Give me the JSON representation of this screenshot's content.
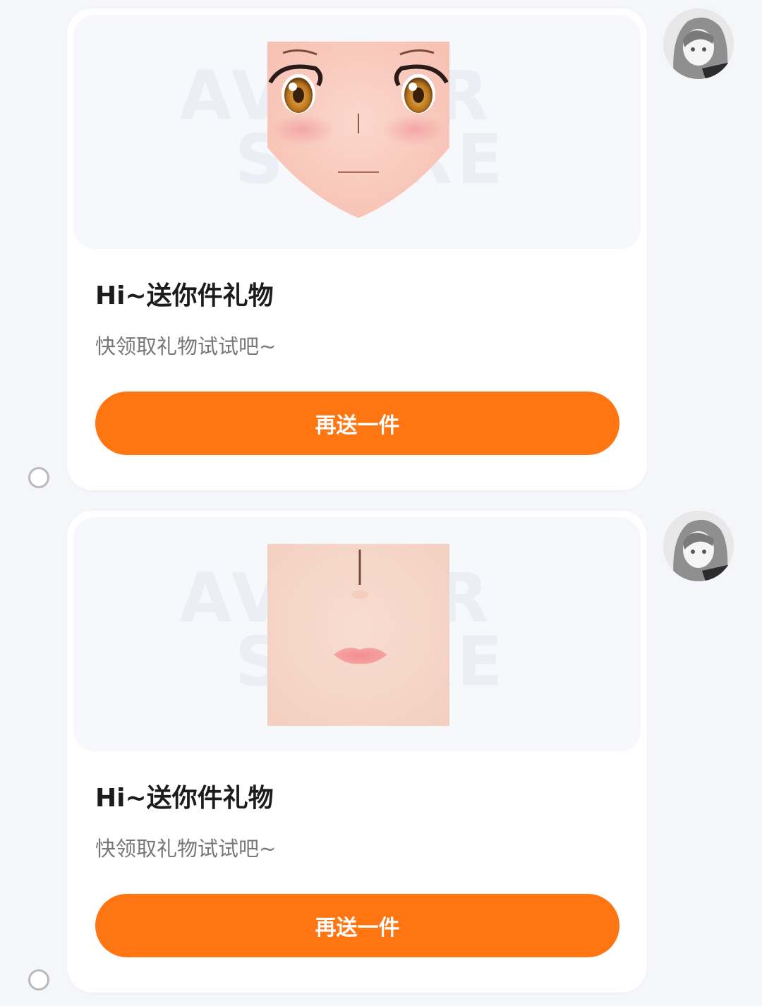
{
  "messages": [
    {
      "title": "Hi~送你件礼物",
      "subtitle": "快领取礼物试试吧~",
      "button_label": "再送一件",
      "preview": "anime-face-eyes-texture",
      "watermark": "AVATAR STORE"
    },
    {
      "title": "Hi~送你件礼物",
      "subtitle": "快领取礼物试试吧~",
      "button_label": "再送一件",
      "preview": "face-nose-lips-texture",
      "watermark": "AVATAR STORE"
    }
  ],
  "colors": {
    "accent": "#ff7512",
    "background": "#f4f6f9",
    "card": "#ffffff"
  }
}
